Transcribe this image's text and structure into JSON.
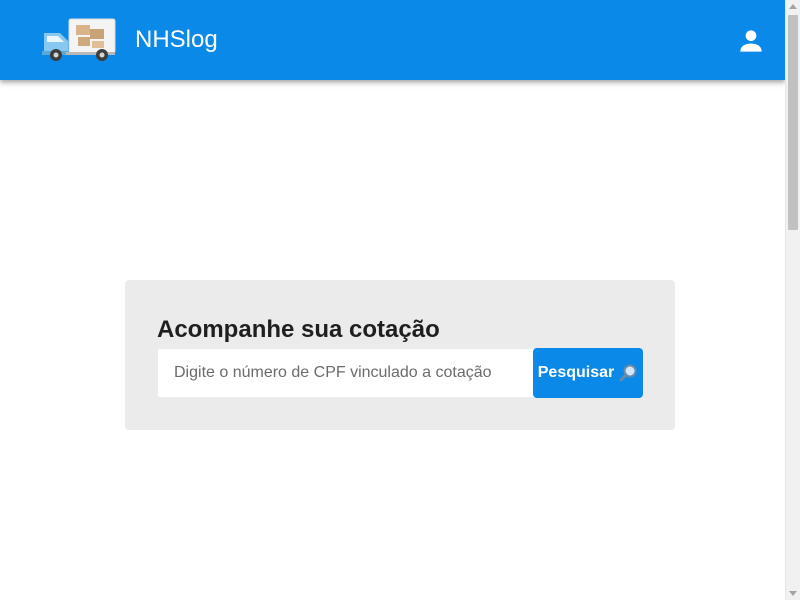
{
  "header": {
    "brand": "NHSlog",
    "logo_icon": "delivery-truck-icon",
    "user_icon": "user-account-icon",
    "background_color": "#0b89e8"
  },
  "main": {
    "card_title": "Acompanhe sua cotação",
    "search": {
      "placeholder": "Digite o número de CPF vinculado a cotação",
      "value": "",
      "button_label": "Pesquisar",
      "button_icon": "magnifier-icon"
    }
  },
  "colors": {
    "accent": "#0b89e8",
    "card_background": "#ebebeb"
  }
}
